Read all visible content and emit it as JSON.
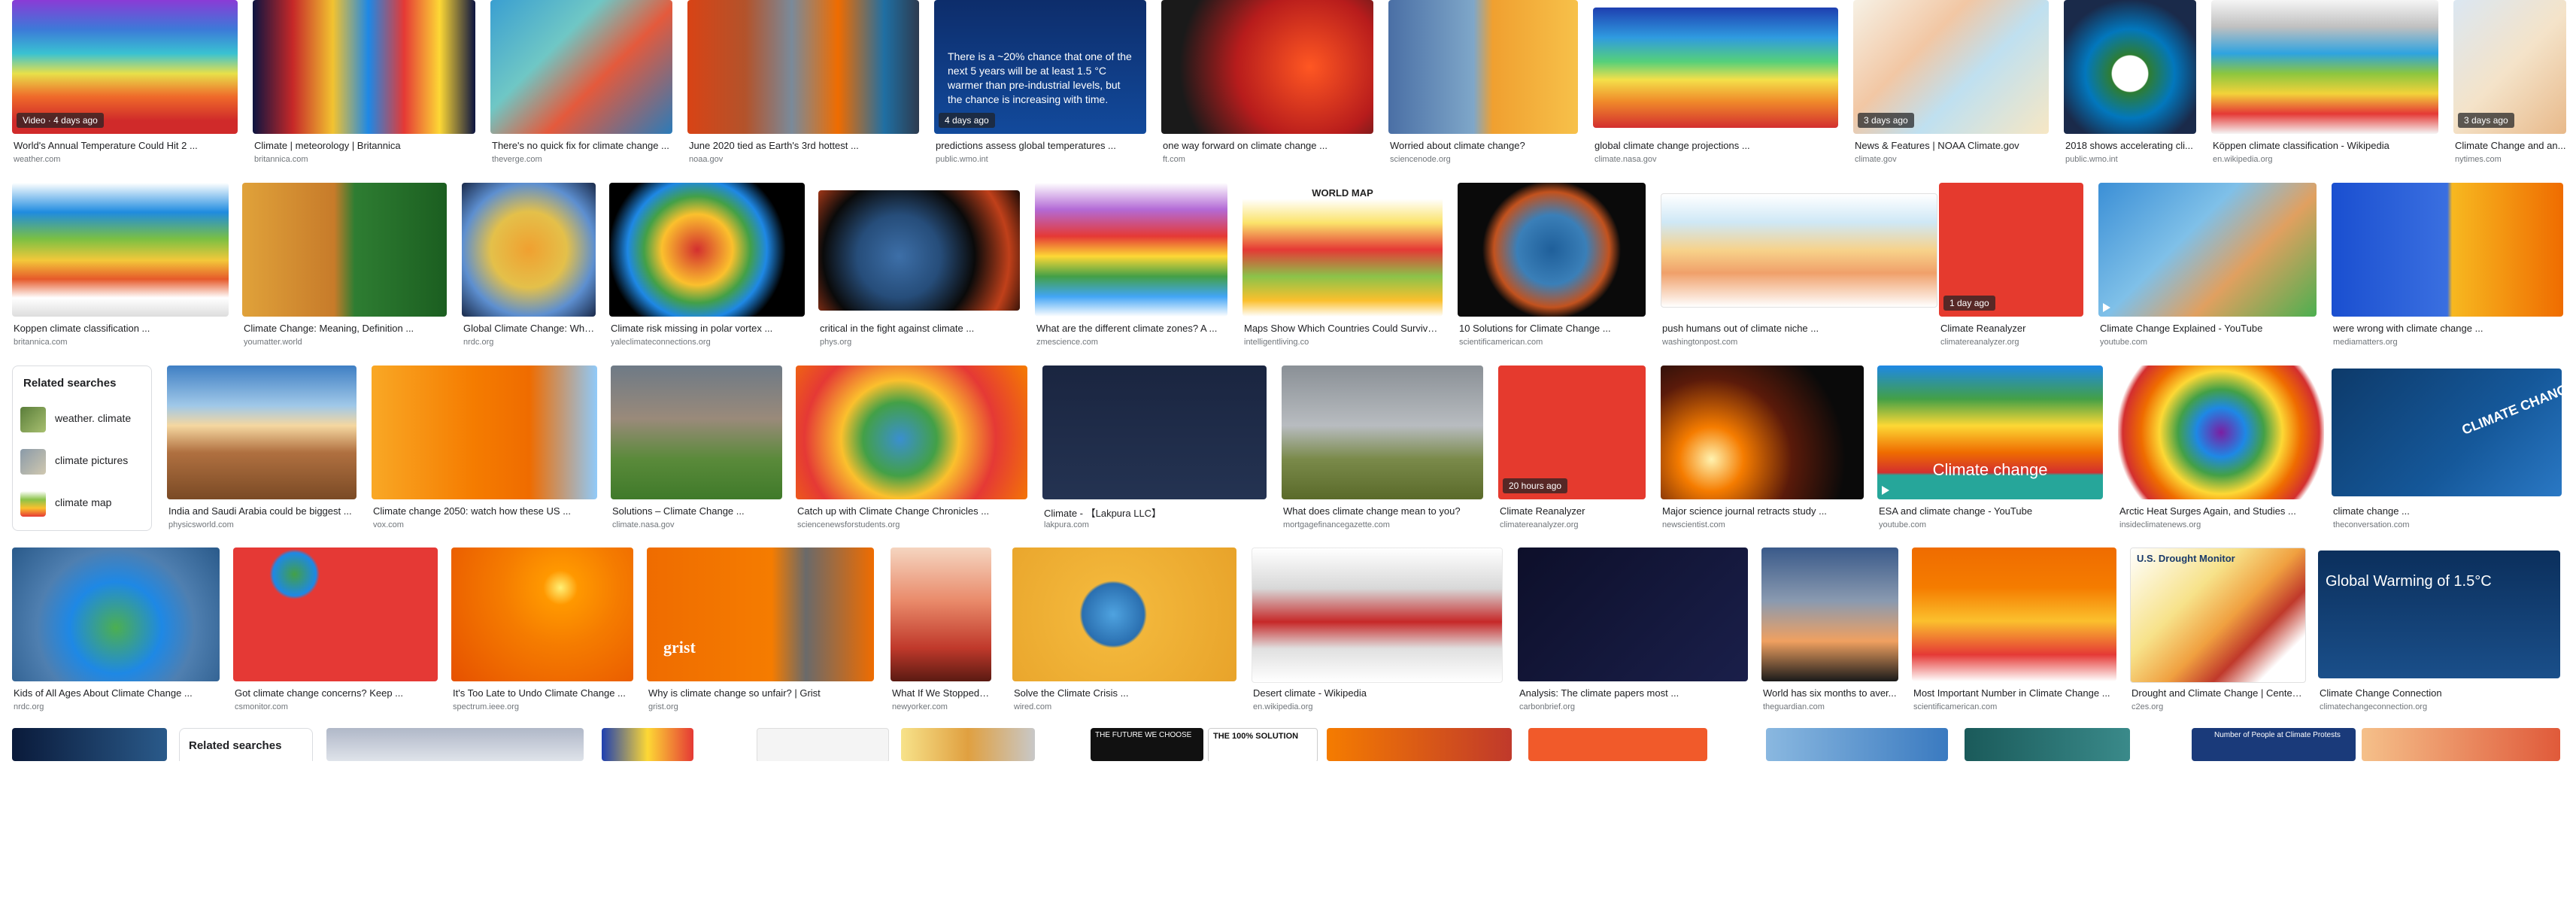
{
  "row1": [
    {
      "title": "World's Annual Temperature Could Hit 2 ...",
      "source": "weather.com",
      "badge": "Video · 4 days ago"
    },
    {
      "title": "Climate | meteorology | Britannica",
      "source": "britannica.com"
    },
    {
      "title": "There's no quick fix for climate change ...",
      "source": "theverge.com"
    },
    {
      "title": "June 2020 tied as Earth's 3rd hottest ...",
      "source": "noaa.gov"
    },
    {
      "title": "predictions assess global temperatures ...",
      "source": "public.wmo.int",
      "badge": "4 days ago",
      "overlay": "There is a ~20% chance that one of the next 5 years will be at least 1.5 °C warmer than pre-industrial levels, but the chance is increasing with time."
    },
    {
      "title": "one way forward on climate change ...",
      "source": "ft.com"
    },
    {
      "title": "Worried about climate change?",
      "source": "sciencenode.org"
    },
    {
      "title": "global climate change projections ...",
      "source": "climate.nasa.gov"
    },
    {
      "title": "News & Features | NOAA Climate.gov",
      "source": "climate.gov",
      "badge": "3 days ago"
    },
    {
      "title": "2018 shows accelerating cli...",
      "source": "public.wmo.int"
    },
    {
      "title": "Köppen climate classification - Wikipedia",
      "source": "en.wikipedia.org"
    },
    {
      "title": "Climate Change and an...",
      "source": "nytimes.com",
      "badge": "3 days ago"
    }
  ],
  "row2": [
    {
      "title": "Koppen climate classification ...",
      "source": "britannica.com"
    },
    {
      "title": "Climate Change: Meaning, Definition ...",
      "source": "youmatter.world"
    },
    {
      "title": "Global Climate Change: Wha...",
      "source": "nrdc.org"
    },
    {
      "title": "Climate risk missing in polar vortex ...",
      "source": "yaleclimateconnections.org"
    },
    {
      "title": "critical in the fight against climate ...",
      "source": "phys.org"
    },
    {
      "title": "What are the different climate zones? A ...",
      "source": "zmescience.com"
    },
    {
      "title": "Maps Show Which Countries Could Survive ...",
      "source": "intelligentliving.co",
      "overlay": "WORLD MAP"
    },
    {
      "title": "10 Solutions for Climate Change ...",
      "source": "scientificamerican.com"
    },
    {
      "title": "push humans out of climate niche ...",
      "source": "washingtonpost.com"
    },
    {
      "title": "Climate Reanalyzer",
      "source": "climatereanalyzer.org",
      "badge": "1 day ago"
    },
    {
      "title": "Climate Change Explained - YouTube",
      "source": "youtube.com",
      "video": true
    },
    {
      "title": "were wrong with climate change ...",
      "source": "mediamatters.org"
    }
  ],
  "related": {
    "heading": "Related searches",
    "items": [
      {
        "label": "weather. climate"
      },
      {
        "label": "climate pictures"
      },
      {
        "label": "climate map"
      }
    ]
  },
  "row3": [
    {
      "title": "India and Saudi Arabia could be biggest ...",
      "source": "physicsworld.com"
    },
    {
      "title": "Climate change 2050: watch how these US ...",
      "source": "vox.com"
    },
    {
      "title": "Solutions – Climate Change ...",
      "source": "climate.nasa.gov"
    },
    {
      "title": "Catch up with Climate Change Chronicles ...",
      "source": "sciencenewsforstudents.org"
    },
    {
      "title": "Climate - 【Lakpura LLC】",
      "source": "lakpura.com"
    },
    {
      "title": "What does climate change mean to you?",
      "source": "mortgagefinancegazette.com"
    },
    {
      "title": "Climate Reanalyzer",
      "source": "climatereanalyzer.org",
      "badge": "20 hours ago"
    },
    {
      "title": "Major science journal retracts study ...",
      "source": "newscientist.com"
    },
    {
      "title": "ESA and climate change - YouTube",
      "source": "youtube.com",
      "video": true,
      "overlay": "Climate change"
    },
    {
      "title": "Arctic Heat Surges Again, and Studies ...",
      "source": "insideclimatenews.org"
    },
    {
      "title": "climate change ...",
      "source": "theconversation.com",
      "overlay": "CLIMATE CHANGE"
    }
  ],
  "row4": [
    {
      "title": "Kids of All Ages About Climate Change ...",
      "source": "nrdc.org"
    },
    {
      "title": "Got climate change concerns? Keep ...",
      "source": "csmonitor.com"
    },
    {
      "title": "It's Too Late to Undo Climate Change ...",
      "source": "spectrum.ieee.org"
    },
    {
      "title": "Why is climate change so unfair? | Grist",
      "source": "grist.org",
      "overlay": "grist"
    },
    {
      "title": "What If We Stopped Pr...",
      "source": "newyorker.com"
    },
    {
      "title": "Solve the Climate Crisis ...",
      "source": "wired.com"
    },
    {
      "title": "Desert climate - Wikipedia",
      "source": "en.wikipedia.org"
    },
    {
      "title": "Analysis: The climate papers most ...",
      "source": "carbonbrief.org"
    },
    {
      "title": "World has six months to aver...",
      "source": "theguardian.com"
    },
    {
      "title": "Most Important Number in Climate Change ...",
      "source": "scientificamerican.com"
    },
    {
      "title": "Drought and Climate Change | Center f...",
      "source": "c2es.org",
      "overlay": "U.S. Drought Monitor"
    },
    {
      "title": "Climate Change Connection",
      "source": "climatechangeconnection.org",
      "overlay": "Global Warming of 1.5°C"
    }
  ],
  "row5": {
    "related_heading": "Related searches",
    "overlay_text_a": "THE FUTURE WE CHOOSE",
    "overlay_text_b": "THE 100% SOLUTION",
    "overlay_text_c": "Number of People at Climate Protests"
  }
}
